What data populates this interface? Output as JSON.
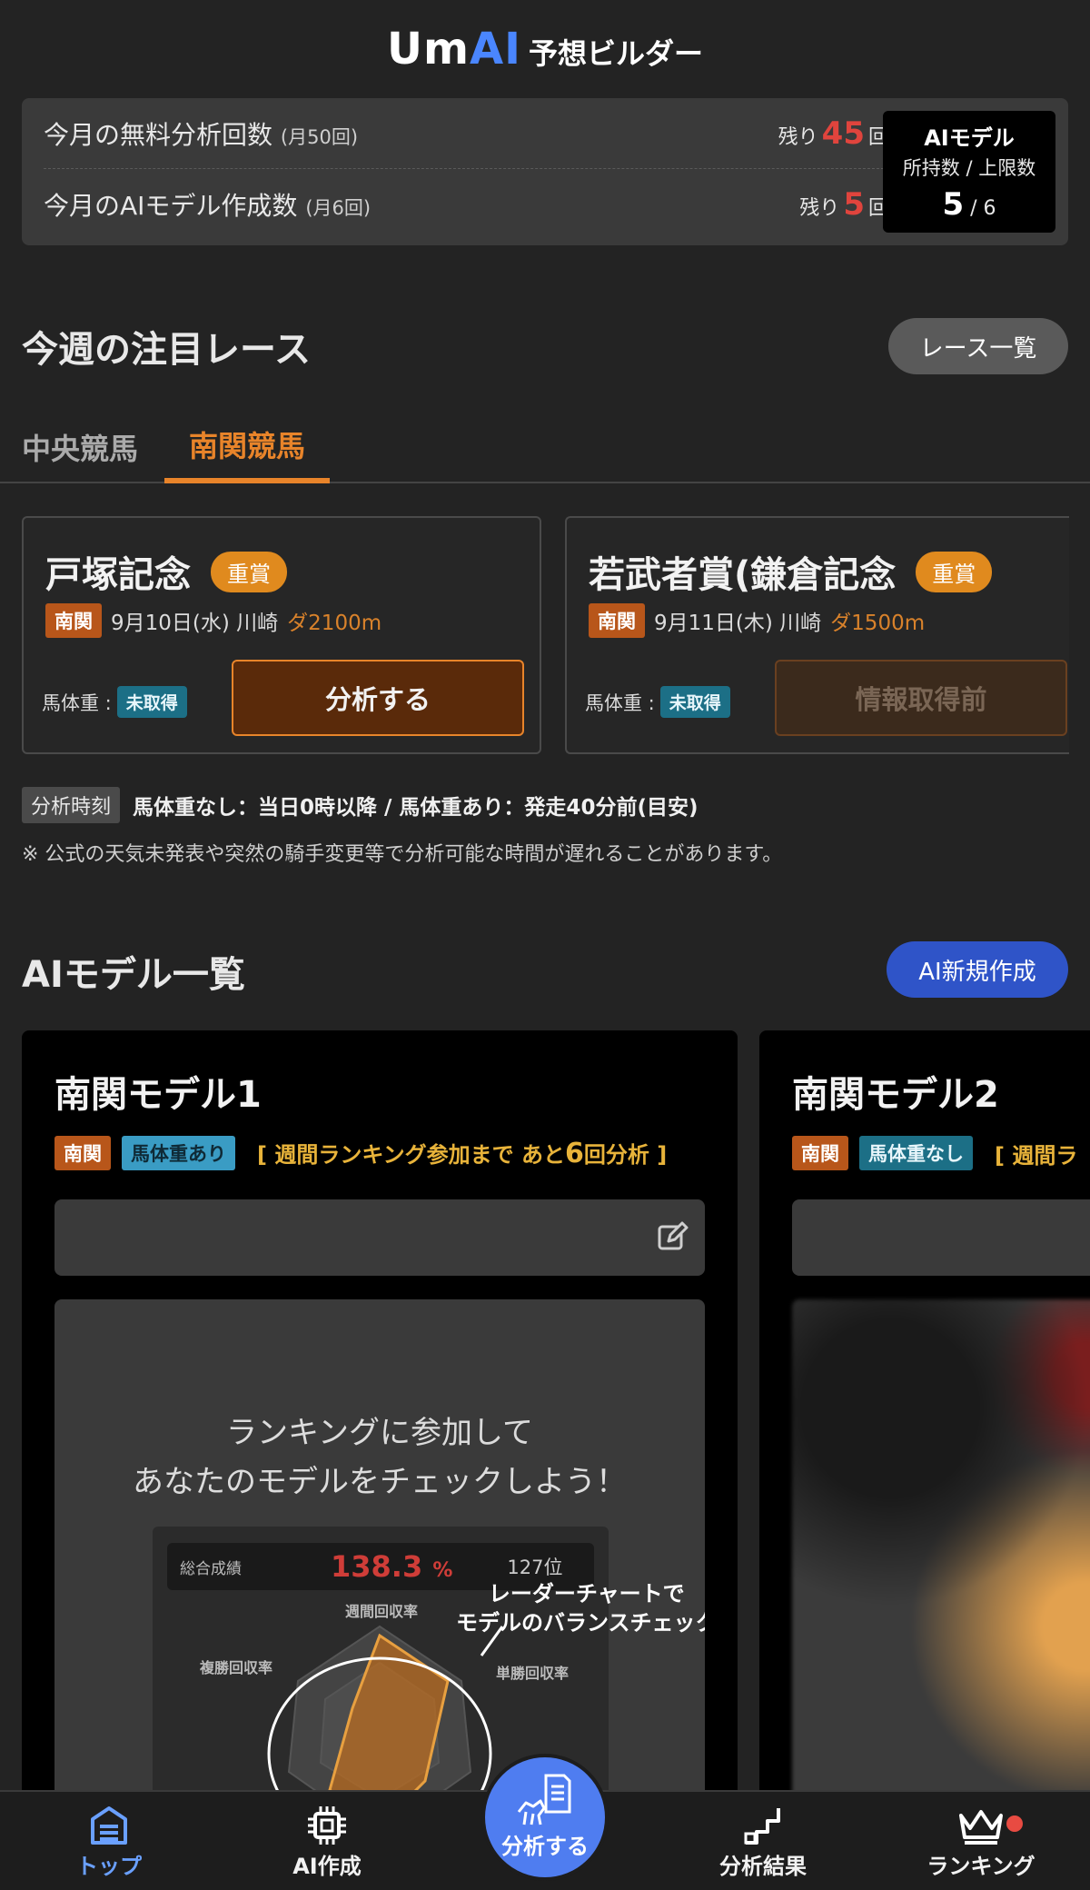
{
  "header": {
    "logo_mark_a": "Um",
    "logo_mark_b": "AI",
    "logo_sub": "予想ビルダー"
  },
  "usage": {
    "free_analysis": {
      "label": "今月の無料分析回数",
      "limit": "(月50回)",
      "prefix": "残り",
      "value": "45",
      "suffix": "回"
    },
    "model_create": {
      "label": "今月のAIモデル作成数",
      "limit": "(月6回)",
      "prefix": "残り",
      "value": "5",
      "suffix": "回"
    },
    "model_count": {
      "title": "AIモデル",
      "sub": "所持数 / 上限数",
      "current": "5",
      "max": " / 6"
    }
  },
  "races_section": {
    "title": "今週の注目レース",
    "list_button": "レース一覧"
  },
  "tabs": [
    {
      "label": "中央競馬",
      "active": false
    },
    {
      "label": "南関競馬",
      "active": true
    }
  ],
  "races": [
    {
      "name": "戸塚記念",
      "grade": "重賞",
      "region": "南関",
      "date": "9月10日(水) 川崎",
      "distance": "ダ2100m",
      "weight_label": "馬体重 :",
      "weight_status": "未取得",
      "button": "分析する",
      "button_state": "active"
    },
    {
      "name": "若武者賞(鎌倉記念",
      "grade": "重賞",
      "region": "南関",
      "date": "9月11日(木) 川崎",
      "distance": "ダ1500m",
      "weight_label": "馬体重 :",
      "weight_status": "未取得",
      "button": "情報取得前",
      "button_state": "disabled"
    }
  ],
  "analysis_time": {
    "tag": "分析時刻",
    "text": "馬体重なし：当日0時以降 / 馬体重あり：発走40分前(目安)"
  },
  "note": "※ 公式の天気未発表や突然の騎手変更等で分析可能な時間が遅れることがあります。",
  "models_section": {
    "title": "AIモデル一覧",
    "new_button": "AI新規作成"
  },
  "models": [
    {
      "name": "南関モデル1",
      "region": "南関",
      "weight": "馬体重あり",
      "rank_hint_pre": "[ 週間ランキング参加まで あと",
      "rank_hint_num": "6",
      "rank_hint_post": "回分析 ]"
    },
    {
      "name": "南関モデル2",
      "region": "南関",
      "weight": "馬体重なし",
      "rank_hint_pre": "[ 週間ラ"
    }
  ],
  "promo": {
    "line1": "ランキングに参加して",
    "line2": "あなたのモデルをチェックしよう！",
    "preview_label": "総合成績",
    "preview_pct": "138.3",
    "preview_pct_unit": "%",
    "preview_rank": "127位",
    "axis_top": "週間回収率",
    "axis_left": "複勝回収率",
    "axis_right": "単勝回収率",
    "callout1": "レーダーチャートで",
    "callout2": "モデルのバランスチェック"
  },
  "nav": [
    {
      "label": "トップ",
      "icon": "home-icon",
      "active": true
    },
    {
      "label": "AI作成",
      "icon": "chip-icon",
      "active": false
    },
    {
      "label": "分析する",
      "icon": "analyze-icon",
      "active": false
    },
    {
      "label": "分析結果",
      "icon": "result-icon",
      "active": false
    },
    {
      "label": "ランキング",
      "icon": "crown-icon",
      "active": false
    }
  ],
  "colors": {
    "accent_orange": "#e8842a",
    "accent_blue": "#4f7df0",
    "remaining_red": "#e0443d",
    "gold": "#e8b33a"
  }
}
